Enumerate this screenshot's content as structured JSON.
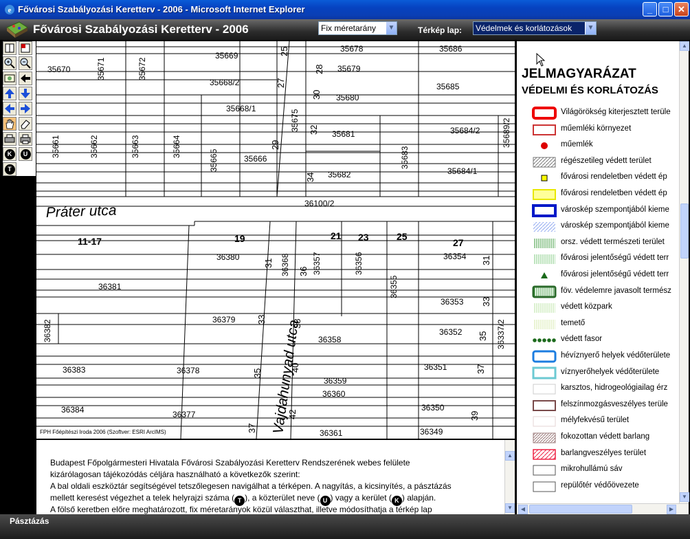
{
  "window": {
    "title": "Fővárosi Szabályozási Keretterv - 2006 - Microsoft Internet Explorer",
    "buttons": [
      "minimize",
      "maximize",
      "close"
    ]
  },
  "app": {
    "title": "Fővárosi Szabályozási Keretterv - 2006",
    "scale_select": "Fix méretarány",
    "map_sheet_label": "Térkép lap:",
    "map_sheet_select": "Védelmek és korlátozások"
  },
  "toolbar": {
    "tools": [
      "map-icon",
      "layers-icon",
      "zoom-in-icon",
      "zoom-out-icon",
      "zoom-full-icon",
      "back-icon",
      "pan-up-icon",
      "pan-down-icon",
      "pan-left-icon",
      "pan-right-icon",
      "pan-hand-icon",
      "eraser-icon",
      "print-icon",
      "print-alt-icon",
      "search-district-icon",
      "search-street-icon",
      "search-parcel-icon"
    ],
    "badges": {
      "k": "K",
      "u": "U",
      "t": "T"
    }
  },
  "map": {
    "parcels": [
      "35669",
      "35678",
      "35686",
      "35670",
      "35671",
      "35672",
      "35679",
      "35668/2",
      "35685",
      "35680",
      "35668/1",
      "35675",
      "35681",
      "35684/2",
      "35689/2",
      "35661",
      "35662",
      "35663",
      "35664",
      "35665",
      "35666",
      "35683",
      "35682",
      "35684/1",
      "36100/2",
      "36380",
      "36368",
      "36357",
      "36356",
      "36354",
      "36381",
      "36355",
      "36353",
      "36382",
      "36379",
      "36358",
      "36352",
      "36337/2",
      "36383",
      "36378",
      "36359",
      "36351",
      "36360",
      "36384",
      "36377",
      "36350",
      "36361",
      "36349"
    ],
    "house_numbers": [
      "25",
      "27",
      "28",
      "30",
      "32",
      "29",
      "34",
      "11-17",
      "19",
      "21",
      "23",
      "25",
      "27",
      "31",
      "36",
      "31",
      "33",
      "33",
      "38",
      "35",
      "40",
      "37",
      "35",
      "42",
      "39",
      "37"
    ],
    "streets": [
      "Práter utca",
      "Vajdahunyad utca"
    ],
    "credit": "FPH Főépítészi Iroda 2006 (Szoftver: ESRI ArcIMS)"
  },
  "legend": {
    "title": "JELMAGYARÁZAT",
    "subtitle": "VÉDELMI ÉS KORLÁTOZÁS",
    "items": [
      {
        "label": "Világörökség kiterjesztett terüle",
        "symbol": "thick-red-box"
      },
      {
        "label": "műemléki környezet",
        "symbol": "red-box"
      },
      {
        "label": "műemlék",
        "symbol": "red-dot"
      },
      {
        "label": "régészetileg védett terület",
        "symbol": "hatched-gray"
      },
      {
        "label": "fővárosi rendeletben védett ép",
        "symbol": "yellow-square"
      },
      {
        "label": "fővárosi rendeletben védett ép",
        "symbol": "yellow-box"
      },
      {
        "label": "városkép szempontjából kieme",
        "symbol": "blue-box"
      },
      {
        "label": "városkép szempontjából kieme",
        "symbol": "blue-hatch"
      },
      {
        "label": "orsz. védett természeti terület",
        "symbol": "green-vlines"
      },
      {
        "label": "fővárosi jelentőségű védett terr",
        "symbol": "green-vlines-light"
      },
      {
        "label": "fővárosi jelentőségű védett terr",
        "symbol": "green-triangle"
      },
      {
        "label": "föv. védelemre javasolt termész",
        "symbol": "green-box"
      },
      {
        "label": "védett közpark",
        "symbol": "pale-green-lines"
      },
      {
        "label": "temető",
        "symbol": "pale-green-lines2"
      },
      {
        "label": "védett fasor",
        "symbol": "green-dots"
      },
      {
        "label": "hévíznyerő helyek védőterülete",
        "symbol": "blue-round-box"
      },
      {
        "label": "víznyerőhelyek védőterülete",
        "symbol": "teal-box"
      },
      {
        "label": "karsztos, hidrogeológiailag érz",
        "symbol": "gray-box"
      },
      {
        "label": "felszínmozgásveszélyes terüle",
        "symbol": "brown-box"
      },
      {
        "label": "mélyfekvésű terület",
        "symbol": "pale-box"
      },
      {
        "label": "fokozottan védett barlang",
        "symbol": "hatched-brown"
      },
      {
        "label": "barlangveszélyes terület",
        "symbol": "red-hatch"
      },
      {
        "label": "mikrohullámú sáv",
        "symbol": "plain-box"
      },
      {
        "label": "repülőtér védőövezete",
        "symbol": "plain-box2"
      }
    ]
  },
  "description": {
    "line1": "Budapest Főpolgármesteri Hivatala Fővárosi Szabályozási Keretterv Rendszerének webes felülete",
    "line2": "kizárólagosan tájékozódás céljára használható a következők szerint:",
    "line3": "A bal oldali eszköztár segítségével tetszőlegesen navigálhat a térképen. A nagyítás, a kicsinyítés, a pásztázás",
    "line4a": "mellett keresést végezhet a telek helyrajzi száma (",
    "line4b": "), a közterület neve (",
    "line4c": ") vagy a kerület (",
    "line4d": ") alapján.",
    "line5": "A fölső keretben előre meghatározott, fix méretarányok közül választhat, illetve módosíthatja a térkép lap"
  },
  "status": {
    "text": "Pásztázás"
  }
}
